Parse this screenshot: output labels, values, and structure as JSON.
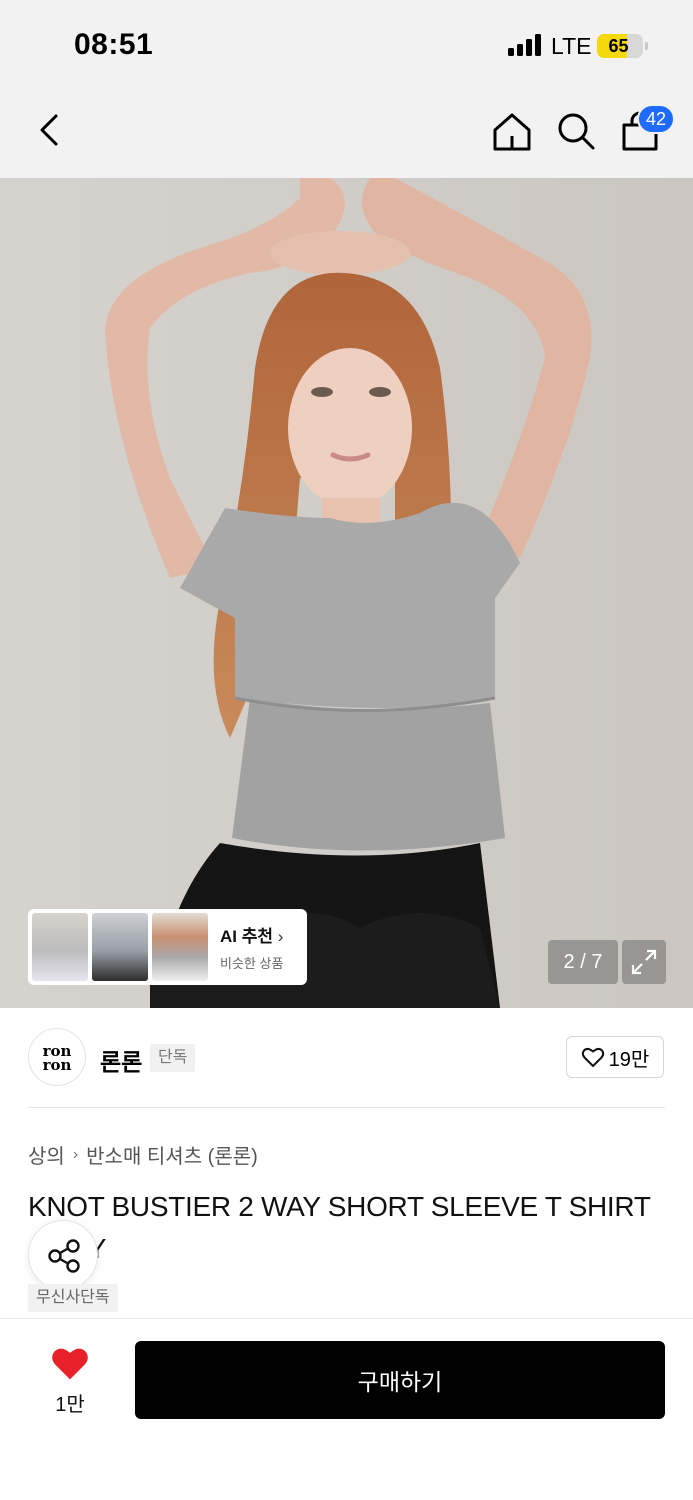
{
  "status_bar": {
    "time": "08:51",
    "network": "LTE",
    "battery_level": 65,
    "battery_text": "65"
  },
  "nav": {
    "back_icon": "chevron-left-icon",
    "home_icon": "home-icon",
    "search_icon": "search-icon",
    "cart_icon": "shopping-bag-icon",
    "cart_count": "42",
    "badge_color": "#1f6bff"
  },
  "gallery": {
    "ai_title": "AI 추천",
    "ai_subtitle": "비슷한 상품",
    "page_indicator": "2 / 7",
    "expand_icon": "expand-icon"
  },
  "brand": {
    "logo_text_top": "ron",
    "logo_text_bottom": "ron",
    "name": "론론",
    "tag": "단독",
    "like_count": "19만"
  },
  "category": {
    "items": [
      "상의",
      "반소매 티셔츠 (론론)"
    ]
  },
  "product": {
    "title": "KNOT BUSTIER 2 WAY SHORT SLEEVE T SHIRT GREY",
    "exclusive_tag": "무신사단독",
    "share_icon": "share-icon"
  },
  "bottom_bar": {
    "wish_icon": "heart-icon",
    "wish_count": "1만",
    "wish_color": "#e8202a",
    "buy_label": "구매하기"
  }
}
